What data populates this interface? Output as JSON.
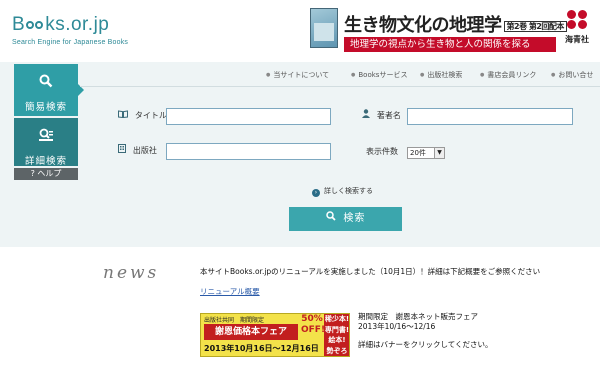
{
  "header": {
    "logo_text_b": "B",
    "logo_text_rest": "ks.or.jp",
    "tagline": "Search Engine for Japanese Books",
    "ad": {
      "title": "生き物文化の地理学",
      "volume_label": "第2巻 第2回配本",
      "subtitle": "地理学の視点から生き物と人の関係を探る",
      "publisher": "海青社"
    }
  },
  "sidebar": {
    "simple_search": "簡易検索",
    "detailed_search": "詳細検索",
    "help": "? ヘルプ"
  },
  "nav": {
    "items": [
      "当サイトについて",
      "Booksサービス",
      "出版社検索",
      "書店会員リンク",
      "お問い合せ"
    ]
  },
  "form": {
    "title_label": "タイトル",
    "author_label": "著者名",
    "publisher_label": "出版社",
    "count_label": "表示件数",
    "count_value": "20件",
    "title_value": "",
    "author_value": "",
    "publisher_value": "",
    "detail_link": "詳しく検索する",
    "search_button": "検索"
  },
  "news": {
    "heading": "news",
    "line1": "本サイトBooks.or.jpのリニューアルを実施しました（10月1日）！詳細は下記概要をご参照ください",
    "link": "リニューアル概要",
    "banner": {
      "top": "出版社共同　期間限定",
      "main": "謝恩価格本フェア",
      "date": "2013年10月16日〜12月16日",
      "off": "50% OFF!!",
      "side": "稀少本! 専門書! 絵本! 勢ぞろい"
    },
    "promo_title": "期間限定　謝恩本ネット販売フェア",
    "promo_date": "2013年10/16〜12/16",
    "promo_note": "詳細はバナーをクリックしてください。"
  },
  "colors": {
    "accent_teal": "#2f9ea6",
    "accent_dark_teal": "#2a7f86",
    "ad_red": "#c40c2a",
    "banner_yellow": "#f3e24a"
  }
}
